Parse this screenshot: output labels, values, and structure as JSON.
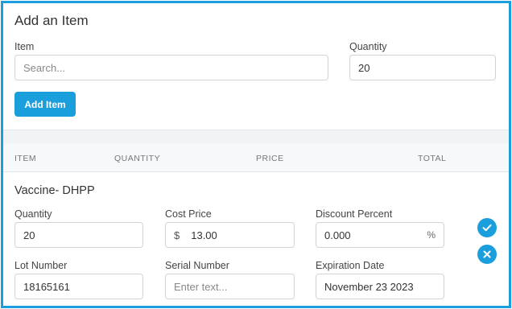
{
  "add_panel": {
    "title": "Add an Item",
    "item_label": "Item",
    "item_placeholder": "Search...",
    "quantity_label": "Quantity",
    "quantity_value": "20",
    "add_button": "Add Item"
  },
  "table_header": {
    "columns": [
      "ITEM",
      "QUANTITY",
      "PRICE",
      "TOTAL"
    ]
  },
  "line_item": {
    "name": "Vaccine- DHPP",
    "quantity_label": "Quantity",
    "quantity_value": "20",
    "cost_price_label": "Cost Price",
    "currency_symbol": "$",
    "cost_price_value": "13.00",
    "discount_label": "Discount Percent",
    "discount_value": "0.000",
    "percent_symbol": "%",
    "lot_label": "Lot Number",
    "lot_value": "18165161",
    "serial_label": "Serial Number",
    "serial_placeholder": "Enter text...",
    "expiration_label": "Expiration Date",
    "expiration_value": "November 23 2023"
  },
  "icons": {
    "confirm": "check-icon",
    "cancel": "close-icon"
  },
  "colors": {
    "accent": "#1a9fdc"
  }
}
